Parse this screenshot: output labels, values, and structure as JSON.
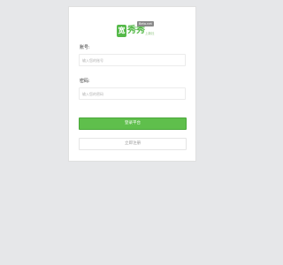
{
  "logo": {
    "mark": "宽",
    "name": "秀秀",
    "badge": "Beta.net",
    "sub": "上新社"
  },
  "form": {
    "account_label": "账号:",
    "account_placeholder": "输入您的账号",
    "password_label": "密码:",
    "password_placeholder": "输入您的密码"
  },
  "buttons": {
    "login": "登录平台",
    "register": "立即注册"
  },
  "colors": {
    "primary": "#5fbf4c",
    "background": "#e6e7e9"
  }
}
